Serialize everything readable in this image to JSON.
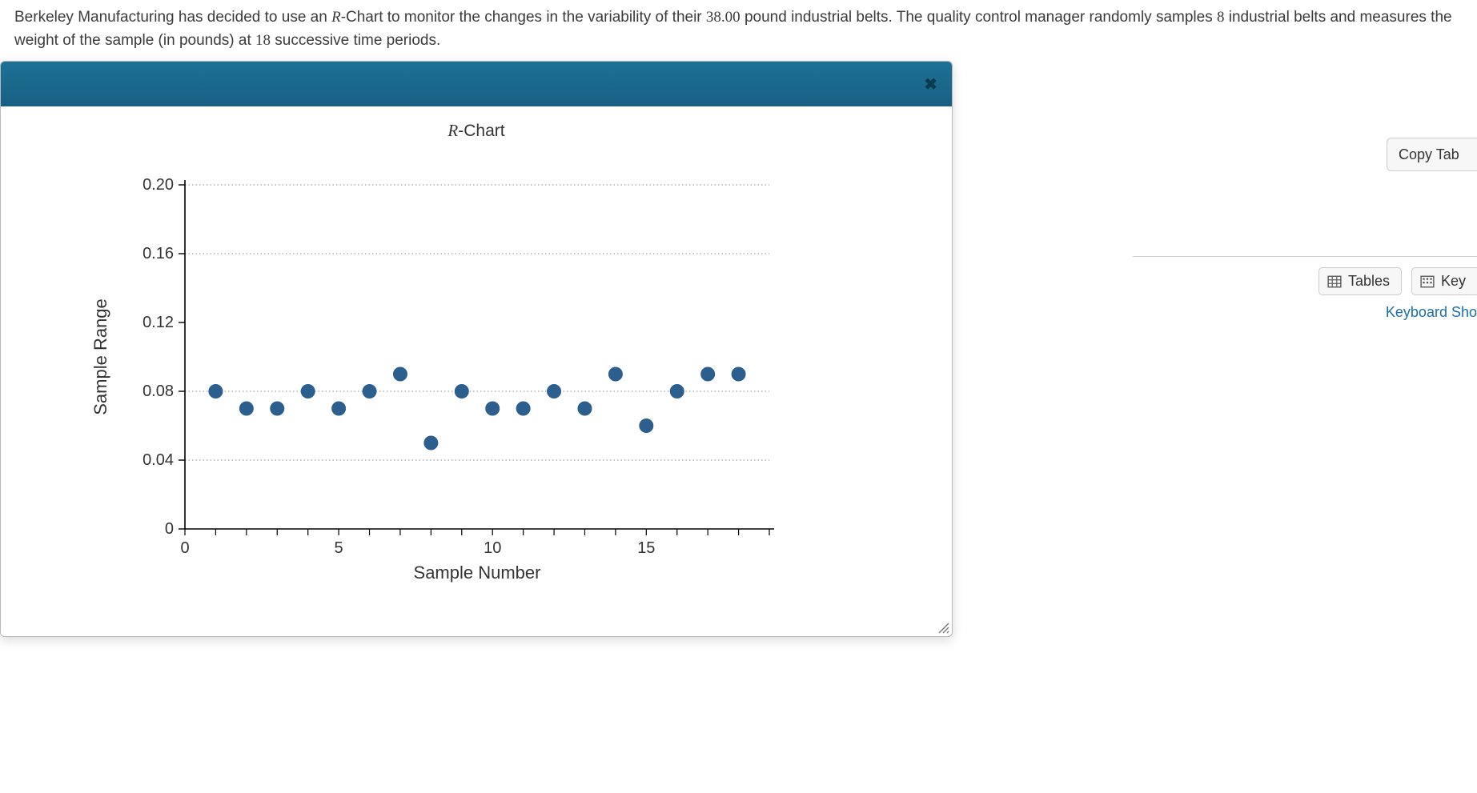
{
  "problem": {
    "part1a": "Berkeley Manufacturing has decided to use an ",
    "r_label": "R",
    "part1b": "-Chart to monitor the changes in the variability of their ",
    "weight": "38.00",
    "part1c": " pound industrial belts.  The quality control manager randomly samples ",
    "sample_size": "8",
    "part1d": " industrial belts and measures the weight of the sample (in pounds) at ",
    "periods": "18",
    "part1e": " successive time periods."
  },
  "modal": {
    "title_prefix": "R",
    "title_suffix": "-Chart",
    "close": "✖"
  },
  "chart_data": {
    "type": "scatter",
    "title": "R-Chart",
    "xlabel": "Sample Number",
    "ylabel": "Sample Range",
    "xlim": [
      0,
      19
    ],
    "ylim": [
      0,
      0.2
    ],
    "xticks": [
      0,
      5,
      10,
      15
    ],
    "yticks": [
      0,
      0.04,
      0.08,
      0.12,
      0.16,
      0.2
    ],
    "gridlines_y": [
      0.04,
      0.08,
      0.16,
      0.2
    ],
    "x": [
      1,
      2,
      3,
      4,
      5,
      6,
      7,
      8,
      9,
      10,
      11,
      12,
      13,
      14,
      15,
      16,
      17,
      18
    ],
    "y": [
      0.08,
      0.07,
      0.07,
      0.08,
      0.07,
      0.08,
      0.09,
      0.05,
      0.08,
      0.07,
      0.07,
      0.08,
      0.07,
      0.09,
      0.06,
      0.08,
      0.09,
      0.09
    ],
    "point_color": "#2c5f8d"
  },
  "sidebar": {
    "copy_tab": "Copy Tab",
    "tables": "Tables",
    "keypad": "Key",
    "kb_shortcuts": "Keyboard Sho"
  },
  "resize_glyph": "⋰"
}
